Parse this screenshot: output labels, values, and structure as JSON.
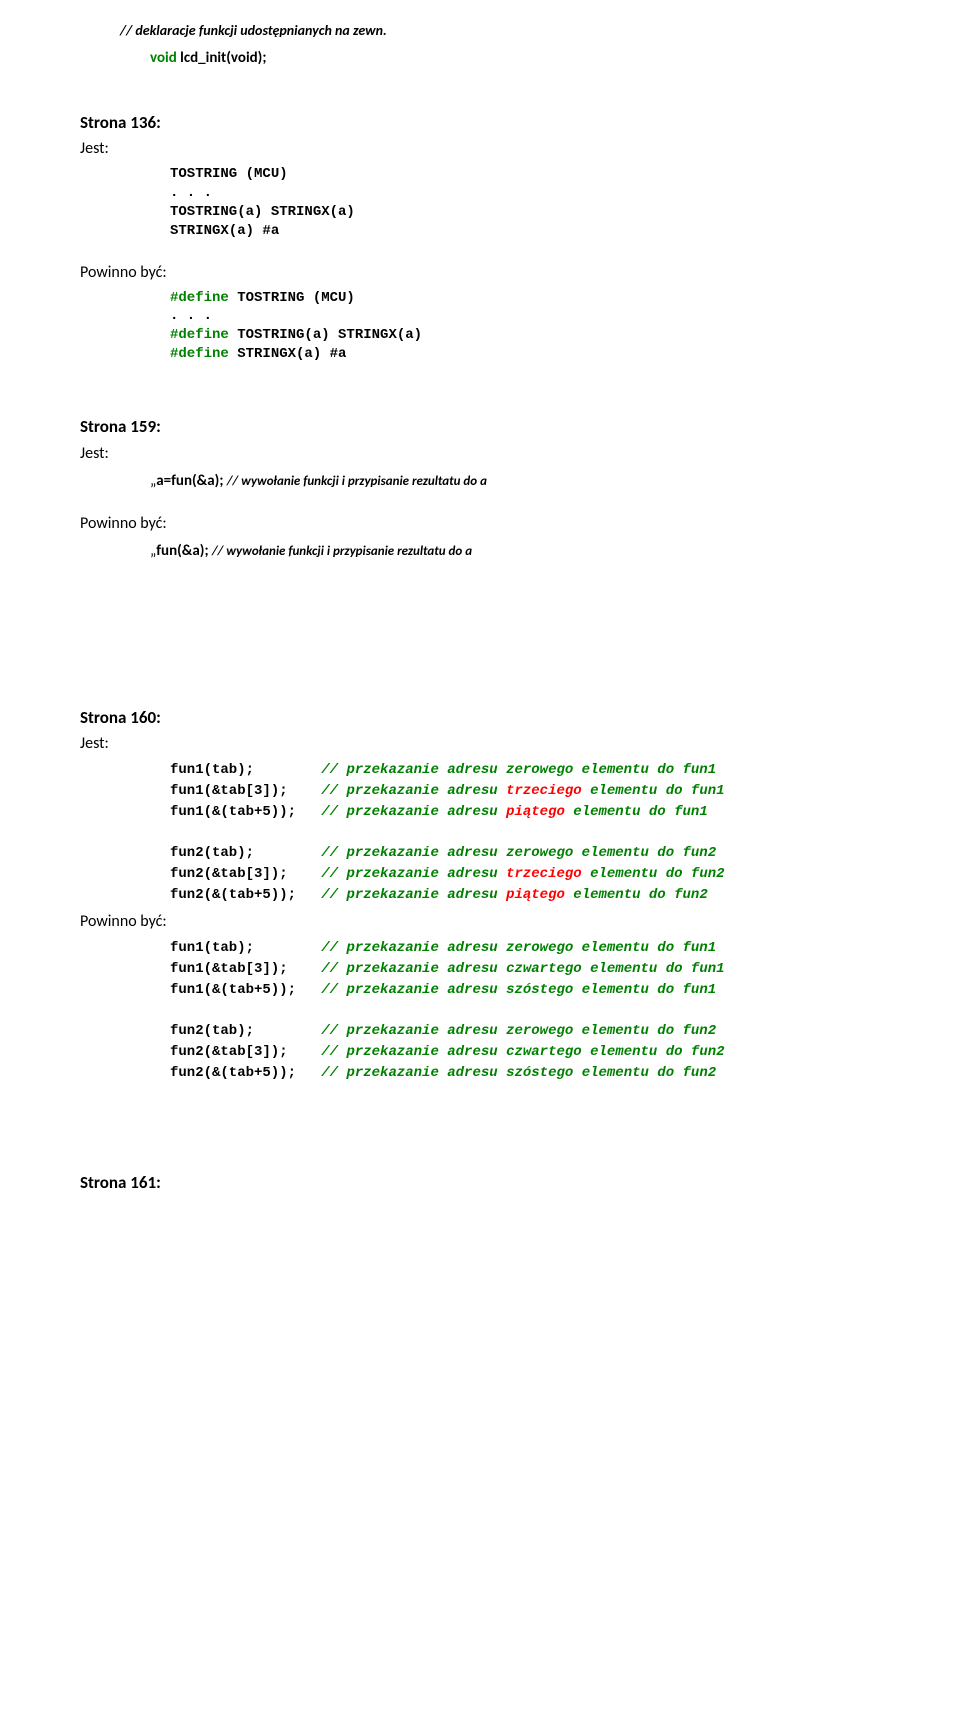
{
  "top": {
    "comment": "// deklaracje funkcji udostępnianych na zewn.",
    "void_kw": "void",
    "void_rest": " lcd_init(void);"
  },
  "s136": {
    "heading": "Strona 136:",
    "jest": "Jest:",
    "l1": "TOSTRING (MCU)",
    "l2": ". . .",
    "l3": "TOSTRING(a)  STRINGX(a)",
    "l4": "STRINGX(a) #a",
    "powinno": "Powinno być:",
    "p1a": "#define",
    "p1b": " TOSTRING (MCU)",
    "p2": ". . .",
    "p3a": "#define",
    "p3b": " TOSTRING(a)  STRINGX(a)",
    "p4a": "#define",
    "p4b": " STRINGX(a) #a"
  },
  "s159": {
    "heading": "Strona 159:",
    "jest": "Jest:",
    "jest_prefix": "„",
    "jest_bold": "a=fun(&a); ",
    "jest_cmt": "// wywołanie funkcji i przypisanie rezultatu do a",
    "powinno": "Powinno być:",
    "pow_prefix": "„",
    "pow_bold": "fun(&a); ",
    "pow_cmt": "// wywołanie funkcji i przypisanie rezultatu do a"
  },
  "s160": {
    "heading": "Strona 160:",
    "jest": "Jest:",
    "powinno": "Powinno być:",
    "jest_block1": [
      {
        "code": "fun1(tab);        ",
        "c1": "// przekazanie adresu zerowego elementu do fun1",
        "hl": "",
        "c2": ""
      },
      {
        "code": "fun1(&tab[3]);    ",
        "c1": "// przekazanie adresu ",
        "hl": "trzeciego",
        "c2": " elementu do fun1"
      },
      {
        "code": "fun1(&(tab+5));   ",
        "c1": "// przekazanie adresu ",
        "hl": "piątego",
        "c2": " elementu do fun1"
      }
    ],
    "jest_block2": [
      {
        "code": "fun2(tab);        ",
        "c1": "// przekazanie adresu zerowego elementu do fun2",
        "hl": "",
        "c2": ""
      },
      {
        "code": "fun2(&tab[3]);    ",
        "c1": "// przekazanie adresu ",
        "hl": "trzeciego",
        "c2": " elementu do fun2"
      },
      {
        "code": "fun2(&(tab+5));   ",
        "c1": "// przekazanie adresu ",
        "hl": "piątego",
        "c2": " elementu do fun2"
      }
    ],
    "pow_block1": [
      {
        "code": "fun1(tab);        ",
        "c1": "// przekazanie adresu zerowego elementu do fun1",
        "hl": "",
        "c2": ""
      },
      {
        "code": "fun1(&tab[3]);    ",
        "c1": "// przekazanie adresu ",
        "hl": "czwartego",
        "c2": " elementu do fun1"
      },
      {
        "code": "fun1(&(tab+5));   ",
        "c1": "// przekazanie adresu ",
        "hl": "szóstego",
        "c2": " elementu do fun1"
      }
    ],
    "pow_block2": [
      {
        "code": "fun2(tab);        ",
        "c1": "// przekazanie adresu zerowego elementu do fun2",
        "hl": "",
        "c2": ""
      },
      {
        "code": "fun2(&tab[3]);    ",
        "c1": "// przekazanie adresu ",
        "hl": "czwartego",
        "c2": " elementu do fun2"
      },
      {
        "code": "fun2(&(tab+5));   ",
        "c1": "// przekazanie adresu ",
        "hl": "szóstego",
        "c2": " elementu do fun2"
      }
    ]
  },
  "s161": {
    "heading": "Strona 161:"
  }
}
